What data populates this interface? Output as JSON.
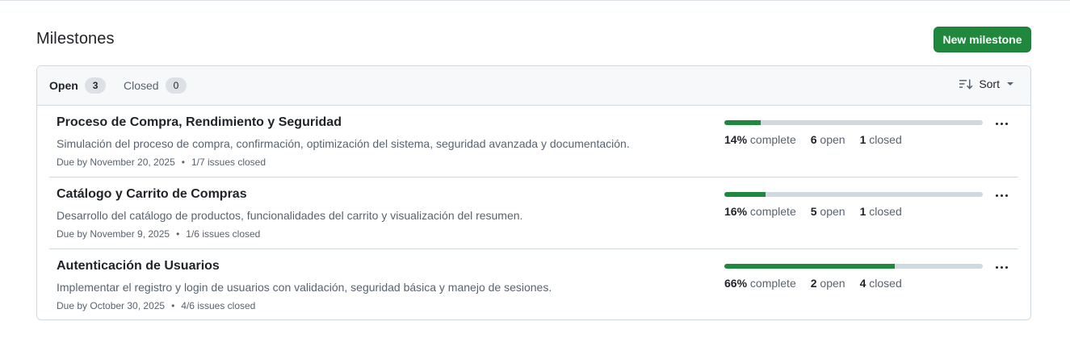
{
  "header": {
    "title": "Milestones",
    "new_button": "New milestone"
  },
  "tabs": {
    "open": {
      "label": "Open",
      "count": "3"
    },
    "closed": {
      "label": "Closed",
      "count": "0"
    },
    "sort_label": "Sort"
  },
  "milestones": [
    {
      "title": "Proceso de Compra, Rendimiento y Seguridad",
      "description": "Simulación del proceso de compra, confirmación, optimización del sistema, seguridad avanzada y documentación.",
      "due": "Due by November 20, 2025",
      "issues": "1/7 issues closed",
      "percent": "14%",
      "complete_label": "complete",
      "open_count": "6",
      "open_label": "open",
      "closed_count": "1",
      "closed_label": "closed",
      "progress": 0.14
    },
    {
      "title": "Catálogo y Carrito de Compras",
      "description": "Desarrollo del catálogo de productos, funcionalidades del carrito y visualización del resumen.",
      "due": "Due by November 9, 2025",
      "issues": "1/6 issues closed",
      "percent": "16%",
      "complete_label": "complete",
      "open_count": "5",
      "open_label": "open",
      "closed_count": "1",
      "closed_label": "closed",
      "progress": 0.16
    },
    {
      "title": "Autenticación de Usuarios",
      "description": "Implementar el registro y login de usuarios con validación, seguridad básica y manejo de sesiones.",
      "due": "Due by October 30, 2025",
      "issues": "4/6 issues closed",
      "percent": "66%",
      "complete_label": "complete",
      "open_count": "2",
      "open_label": "open",
      "closed_count": "4",
      "closed_label": "closed",
      "progress": 0.66
    }
  ],
  "icons": {
    "sort": "sort-desc-icon",
    "more": "kebab-horizontal-icon",
    "caret": "triangle-down-icon"
  },
  "colors": {
    "accent": "#1f883d",
    "track": "#d1d9e0"
  }
}
